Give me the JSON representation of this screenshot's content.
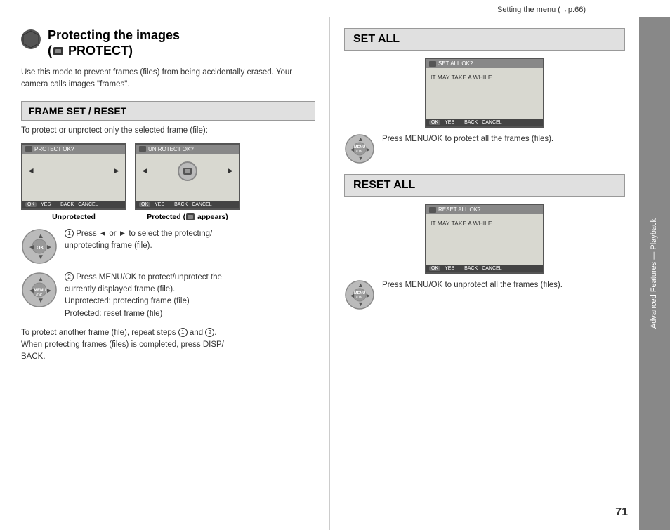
{
  "header": {
    "breadcrumb": "Setting the menu (→p.66)"
  },
  "page_number": "71",
  "sidebar": {
    "label": "Advanced Features — Playback"
  },
  "left_section": {
    "title_line1": "Protecting the images",
    "title_line2": "(  PROTECT)",
    "description": "Use this mode to prevent frames (files) from being accidentally erased. Your camera calls images \"frames\".",
    "frame_set_reset": {
      "heading": "FRAME SET / RESET",
      "desc": "To protect or unprotect only the selected frame (file):",
      "screen1_label": "Unprotected",
      "screen2_label": "Protected (   appears)",
      "screen1_title": "PROTECT OK?",
      "screen2_title": "UN  ROTECT OK?",
      "screen_bottom": "YES    CANCEL",
      "step1_text": "Press ◄ or ► to select the protecting/\nunprotecting frame (file).",
      "step2_text": "Press MENU/OK to protect/unprotect the\ncurrently displayed frame (file).\nUnprotected: protecting frame (file)\nProtected: reset frame (file)",
      "footer_text": "To protect another frame (file), repeat steps   and  .\nWhen protecting frames (files) is completed, press DISP/\nBACK."
    }
  },
  "right_section": {
    "set_all": {
      "heading": "SET ALL",
      "screen_title": "SET ALL OK?",
      "screen_subtitle": "IT MAY TAKE A WHILE",
      "screen_bottom": "YES    CANCEL",
      "instruction": "Press MENU/OK to protect all the frames (files)."
    },
    "reset_all": {
      "heading": "RESET ALL",
      "screen_title": "RESET ALL OK?",
      "screen_subtitle": "IT MAY TAKE A WHILE",
      "screen_bottom": "YES    CANCEL",
      "instruction": "Press MENU/OK to unprotect all the frames (files)."
    }
  }
}
